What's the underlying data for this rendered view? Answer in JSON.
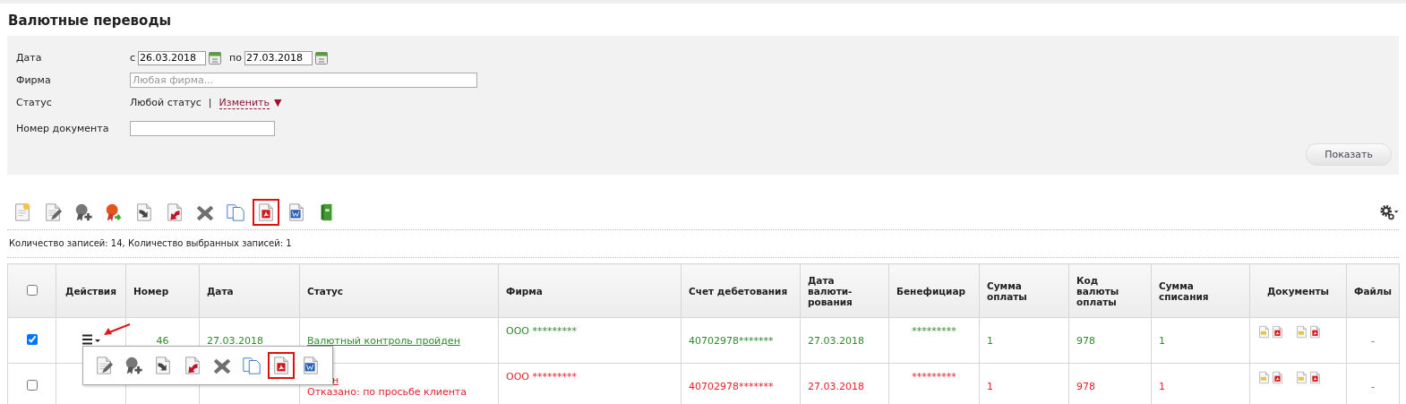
{
  "title": "Валютные переводы",
  "filter": {
    "date_label": "Дата",
    "from_label": "с",
    "from_value": "26.03.2018",
    "to_label": "по",
    "to_value": "27.03.2018",
    "firm_label": "Фирма",
    "firm_placeholder": "Любая фирма...",
    "status_label": "Статус",
    "status_value": "Любой статус",
    "separator": "|",
    "change_link": "Изменить",
    "change_caret": "▼",
    "docnum_label": "Номер документа",
    "show_button": "Показать"
  },
  "toolbar": [
    {
      "kind": "new",
      "highlighted": false
    },
    {
      "kind": "edit",
      "highlighted": false
    },
    {
      "kind": "sign-add",
      "highlighted": false
    },
    {
      "kind": "sign",
      "highlighted": false
    },
    {
      "kind": "send",
      "highlighted": false
    },
    {
      "kind": "recall",
      "highlighted": false
    },
    {
      "kind": "delete",
      "highlighted": false
    },
    {
      "kind": "copy",
      "highlighted": false
    },
    {
      "kind": "pdf",
      "highlighted": true
    },
    {
      "kind": "word",
      "highlighted": false
    },
    {
      "kind": "archive",
      "highlighted": false
    }
  ],
  "count_text": "Количество записей: 14, Количество выбранных записей: 1",
  "table": {
    "header_checked": false,
    "columns": [
      "Действия",
      "Номер",
      "Дата",
      "Статус",
      "Фирма",
      "Счет дебетования",
      "Дата валюти-рования",
      "Бенефициар",
      "Сумма оплаты",
      "Код валюты оплаты",
      "Сумма списания",
      "Документы",
      "Файлы"
    ],
    "rows": [
      {
        "kind": "passed",
        "checked": true,
        "number": "46",
        "date": "27.03.2018",
        "status": "Валютный контроль пройден",
        "firm": "ООО *********",
        "account": "40702978*******",
        "value_date": "27.03.2018",
        "beneficiary": "*********",
        "amount": "1",
        "currency": "978",
        "debit": "1",
        "files": "-"
      },
      {
        "kind": "rejected",
        "checked": false,
        "status": "н",
        "status_note": "Отказано: по просьбе клиента",
        "firm": "ООО *********",
        "account": "40702978*******",
        "value_date": "27.03.2018",
        "beneficiary": "*********",
        "amount": "1",
        "currency": "978",
        "debit": "1",
        "files": "-"
      }
    ]
  },
  "actions_menu": [
    {
      "kind": "edit",
      "highlighted": false
    },
    {
      "kind": "sign-add",
      "highlighted": false
    },
    {
      "kind": "send",
      "highlighted": false
    },
    {
      "kind": "recall",
      "highlighted": false
    },
    {
      "kind": "delete",
      "highlighted": false
    },
    {
      "kind": "copy",
      "highlighted": false
    },
    {
      "kind": "pdf",
      "highlighted": true
    },
    {
      "kind": "word",
      "highlighted": false
    }
  ]
}
